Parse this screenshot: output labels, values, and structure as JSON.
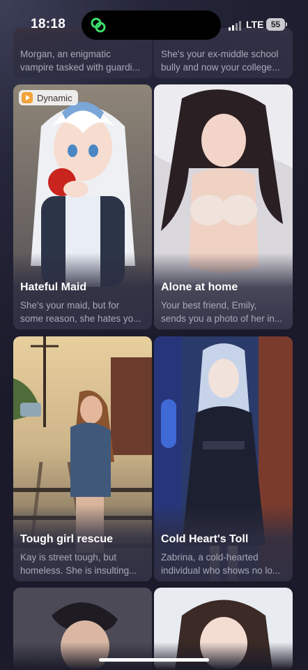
{
  "status_bar": {
    "time": "18:18",
    "network": "LTE",
    "battery": "55"
  },
  "cards": [
    {
      "title": "",
      "desc_line1": "Morgan, an enigmatic",
      "desc_line2": "vampire tasked with guardi..."
    },
    {
      "title": "",
      "desc_line1": "She's your ex-middle school",
      "desc_line2": "bully and now your college..."
    },
    {
      "title": "Hateful Maid",
      "desc_line1": "She's your maid, but for",
      "desc_line2": "some reason, she hates yo...",
      "badge": "Dynamic"
    },
    {
      "title": "Alone at home",
      "desc_line1": "Your best friend, Emily,",
      "desc_line2": "sends you a photo of her in..."
    },
    {
      "title": "Tough girl rescue",
      "desc_line1": "Kay is street tough, but",
      "desc_line2": "homeless. She is insulting..."
    },
    {
      "title": "Cold Heart's Toll",
      "desc_line1": "Zabrina, a cold-hearted",
      "desc_line2": "individual who shows no lo..."
    }
  ],
  "colors": {
    "background": "#25263a",
    "card": "#2e2f44",
    "description": "#a8a9b8",
    "badge_accent": "#f2a33a",
    "island_accent": "#3ddc6a"
  }
}
